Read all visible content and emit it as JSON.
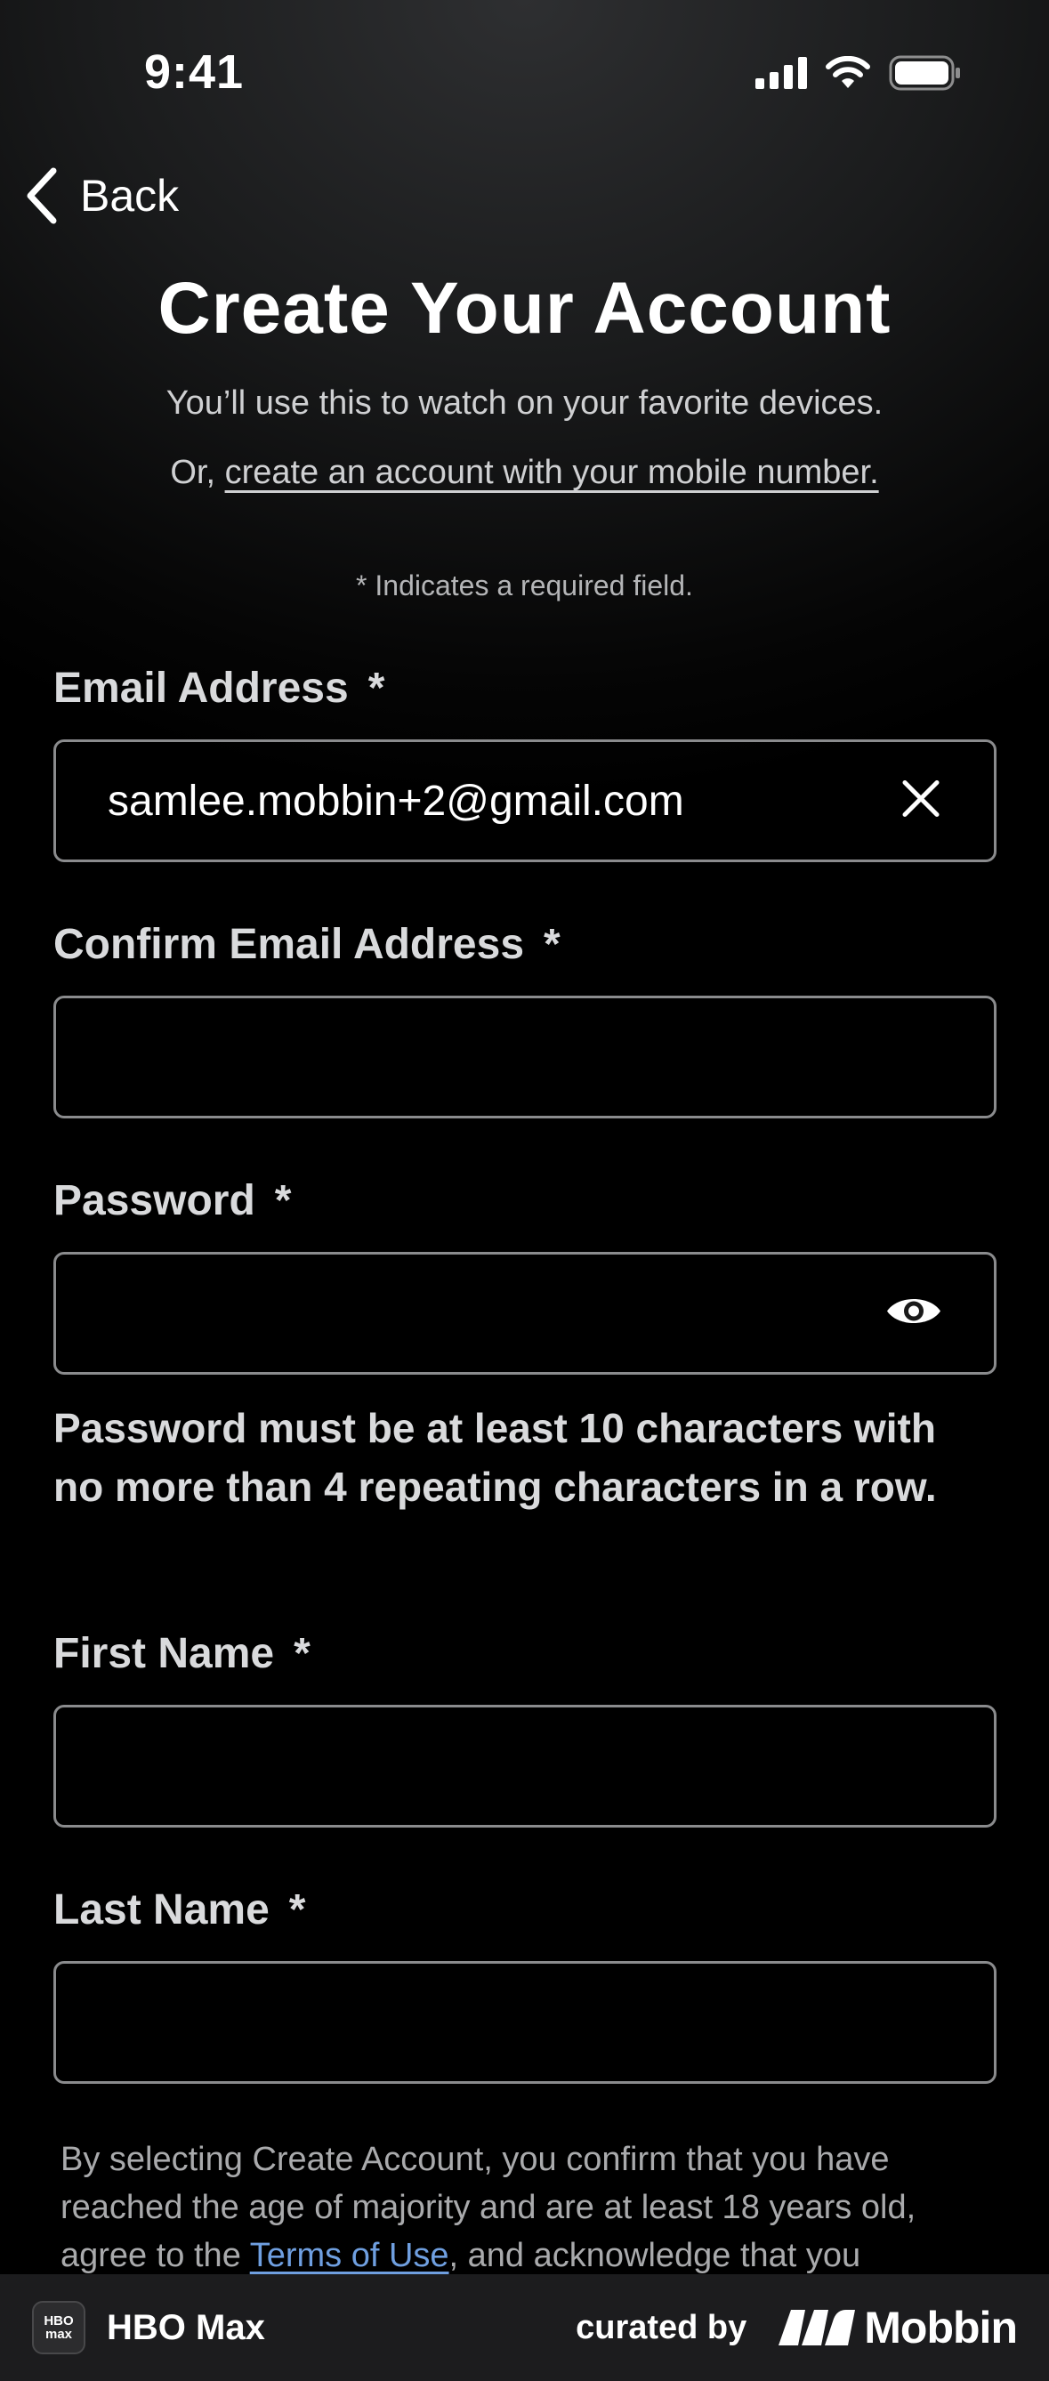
{
  "status_bar": {
    "time": "9:41"
  },
  "nav": {
    "back_label": "Back"
  },
  "header": {
    "title": "Create Your Account",
    "subtitle": "You’ll use this to watch on your favorite devices.",
    "alt_prefix": "Or, ",
    "alt_link": "create an account with your mobile number."
  },
  "required_note": "* Indicates a required field.",
  "form": {
    "email": {
      "label": "Email Address",
      "star": "*",
      "value": "samlee.mobbin+2@gmail.com"
    },
    "confirm_email": {
      "label": "Confirm Email Address",
      "star": "*",
      "value": ""
    },
    "password": {
      "label": "Password",
      "star": "*",
      "value": ""
    },
    "password_hint": "Password must be at least 10 characters with no more than 4 repeating characters in a row.",
    "first_name": {
      "label": "First Name",
      "star": "*",
      "value": ""
    },
    "last_name": {
      "label": "Last Name",
      "star": "*",
      "value": ""
    }
  },
  "legal": {
    "prefix": "By selecting Create Account, you confirm that you have reached the age of majority and are at least 18 years old, agree to the ",
    "terms_link": "Terms of Use",
    "suffix": ", and acknowledge that you"
  },
  "footer": {
    "app_logo_text": "HBO max",
    "app_name": "HBO Max",
    "curated_by": "curated by",
    "brand": "Mobbin"
  }
}
